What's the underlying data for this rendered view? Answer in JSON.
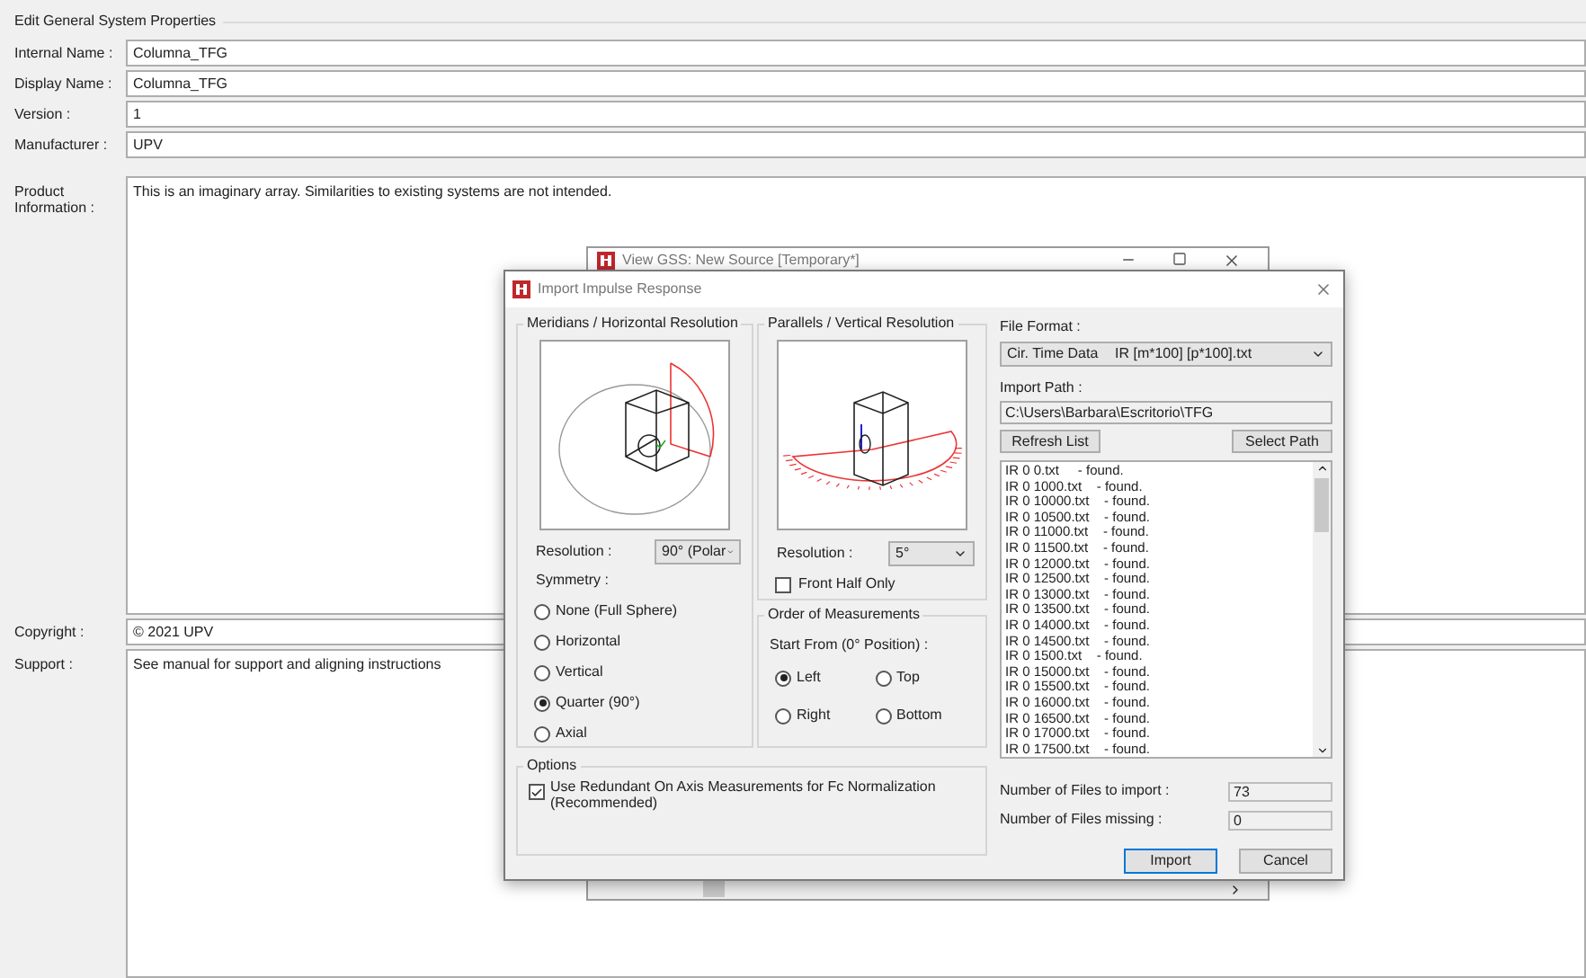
{
  "page": {
    "title": "Edit General System Properties",
    "fields": [
      {
        "label": "Internal Name :",
        "value": "Columna_TFG",
        "kind": "line"
      },
      {
        "label": "Display Name :",
        "value": "Columna_TFG",
        "kind": "line"
      },
      {
        "label": "Version :",
        "value": "1",
        "kind": "line"
      },
      {
        "label": "Manufacturer :",
        "value": "UPV",
        "kind": "line"
      },
      {
        "label": "Product Information :",
        "value": "This is an imaginary array. Similarities to existing systems are not intended.",
        "kind": "area"
      },
      {
        "label": "Copyright :",
        "value": "© 2021 UPV",
        "kind": "line"
      },
      {
        "label": "Support :",
        "value": "See manual for support and aligning instructions",
        "kind": "area"
      }
    ]
  },
  "background_window": {
    "title": "View GSS: New Source [Temporary*]"
  },
  "dialog": {
    "title": "Import Impulse Response",
    "meridians": {
      "legend": "Meridians / Horizontal Resolution",
      "resolution_label": "Resolution :",
      "resolution_value": "90° (Polar",
      "symmetry_label": "Symmetry :",
      "symmetry_options": [
        {
          "label": "None (Full Sphere)",
          "selected": false
        },
        {
          "label": "Horizontal",
          "selected": false
        },
        {
          "label": "Vertical",
          "selected": false
        },
        {
          "label": "Quarter (90°)",
          "selected": true
        },
        {
          "label": "Axial",
          "selected": false
        }
      ]
    },
    "parallels": {
      "legend": "Parallels / Vertical Resolution",
      "resolution_label": "Resolution :",
      "resolution_value": "5°",
      "front_half_only": {
        "label": "Front Half Only",
        "checked": false
      }
    },
    "order": {
      "legend": "Order of Measurements",
      "start_label": "Start From (0° Position) :",
      "options": [
        {
          "label": "Left",
          "selected": true
        },
        {
          "label": "Top",
          "selected": false
        },
        {
          "label": "Right",
          "selected": false
        },
        {
          "label": "Bottom",
          "selected": false
        }
      ]
    },
    "options": {
      "legend": "Options",
      "redundant": {
        "label": "Use Redundant On Axis Measurements for Fc Normalization (Recommended)",
        "checked": true
      }
    },
    "file_format": {
      "label": "File Format :",
      "value_1": "Cir. Time Data",
      "value_2": "IR [m*100] [p*100].txt"
    },
    "import_path": {
      "label": "Import Path :",
      "value": "C:\\Users\\Barbara\\Escritorio\\TFG"
    },
    "path_buttons": [
      "Refresh List",
      "Select Path"
    ],
    "files": [
      "IR 0 0.txt     - found.",
      "IR 0 1000.txt    - found.",
      "IR 0 10000.txt    - found.",
      "IR 0 10500.txt    - found.",
      "IR 0 11000.txt    - found.",
      "IR 0 11500.txt    - found.",
      "IR 0 12000.txt    - found.",
      "IR 0 12500.txt    - found.",
      "IR 0 13000.txt    - found.",
      "IR 0 13500.txt    - found.",
      "IR 0 14000.txt    - found.",
      "IR 0 14500.txt    - found.",
      "IR 0 1500.txt    - found.",
      "IR 0 15000.txt    - found.",
      "IR 0 15500.txt    - found.",
      "IR 0 16000.txt    - found.",
      "IR 0 16500.txt    - found.",
      "IR 0 17000.txt    - found.",
      "IR 0 17500.txt    - found."
    ],
    "count_import": {
      "label": "Number of Files to import :",
      "value": "73"
    },
    "count_missing": {
      "label": "Number of Files missing :",
      "value": "0"
    },
    "buttons": [
      {
        "label": "Import",
        "default": true
      },
      {
        "label": "Cancel",
        "default": false
      }
    ]
  }
}
